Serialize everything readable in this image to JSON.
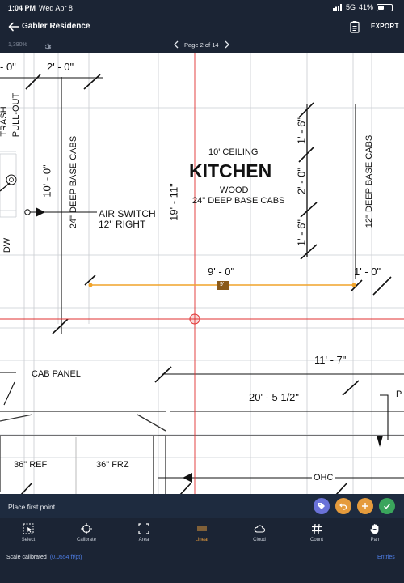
{
  "status_bar": {
    "time": "1:04 PM",
    "date": "Wed Apr 8",
    "network": "5G",
    "battery": "41%",
    "battery_level": 0.41
  },
  "nav": {
    "title": "Gabler Residence",
    "export_label": "EXPORT"
  },
  "sub_bar": {
    "zoom": "1,390%",
    "page_label": "Page 2 of 14"
  },
  "drawing": {
    "top_left_dim": "- 0\"",
    "top_dim": "2' - 0\"",
    "trash_label_1": "TRASH",
    "trash_label_2": "PULL-OUT",
    "ceiling": "10' CEILING",
    "room": "KITCHEN",
    "material": "WOOD",
    "base_cabs": "24\" DEEP BASE CABS",
    "left_cabs": "24\" DEEP BASE CABS",
    "right_cabs": "12\" DEEP BASE CABS",
    "wall_dim": "10' - 0\"",
    "room_height": "19' - 11\"",
    "seg_top": "1' - 6\"",
    "seg_mid": "2' - 0\"",
    "seg_bottom": "1' - 6\"",
    "air_switch": "AIR SWITCH",
    "air_switch_sub": "12\" RIGHT",
    "dw": "DW",
    "linear_measure": "9' - 0\"",
    "linear_tag": "9'",
    "right_measure": "1' - 0\"",
    "dim_11_7": "11' - 7\"",
    "dim_20_5": "20' - 5 1/2\"",
    "cab_panel": "CAB PANEL",
    "ref": "36\" REF",
    "frz": "36\" FRZ",
    "ohc": "OHC",
    "cut_label": "P"
  },
  "status_line": {
    "prompt": "Place first point"
  },
  "toolbar": {
    "select": "Select",
    "calibrate": "Calibrate",
    "area": "Area",
    "linear": "Linear",
    "cloud": "Cloud",
    "count": "Count",
    "pan": "Pan"
  },
  "bottom": {
    "scale_label": "Scale calibrated",
    "scale_value": "(0.0554 ft/pt)",
    "entries_label": "Entries"
  },
  "colors": {
    "accent_orange": "#e59b3c",
    "accent_blue": "#4f7fe8",
    "confirm_green": "#3aa55c",
    "tag_purple": "#6a72d8",
    "measure_line": "#f0a32a",
    "red_guide": "#e03030"
  }
}
